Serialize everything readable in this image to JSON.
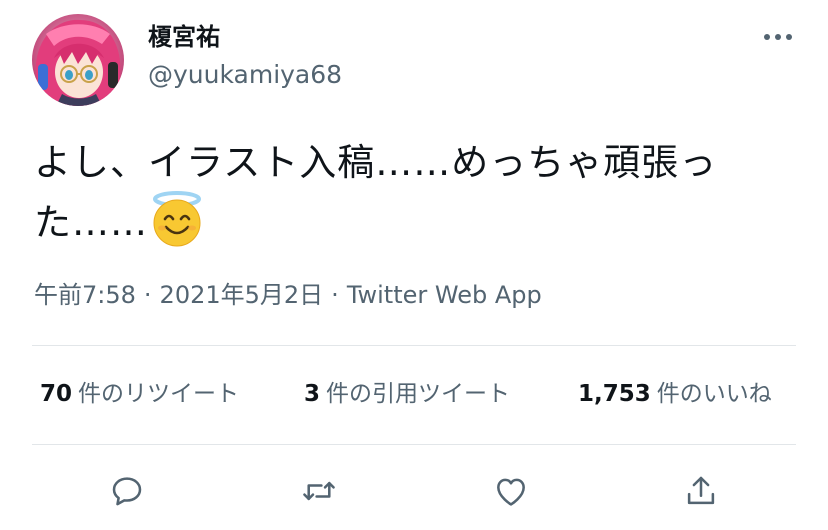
{
  "author": {
    "display_name": "榎宮祐",
    "handle": "@yuukamiya68",
    "avatar_icon": "user-avatar-image"
  },
  "tweet": {
    "text_lines": [
      "よし、イラスト入稿……めっちゃ頑張っ",
      "た……"
    ],
    "emoji": "smiling-face-with-halo"
  },
  "meta": {
    "time": "午前7:58",
    "separator": "·",
    "date": "2021年5月2日",
    "source": "Twitter Web App"
  },
  "stats": {
    "retweets": {
      "count": "70",
      "label": "件のリツイート"
    },
    "quotes": {
      "count": "3",
      "label": "件の引用ツイート"
    },
    "likes": {
      "count": "1,753",
      "label": "件のいいね"
    }
  },
  "actions": [
    "reply-icon",
    "retweet-icon",
    "like-icon",
    "share-icon"
  ],
  "colors": {
    "text": "#0f1419",
    "secondary": "#536471",
    "divider": "#e2e6e9",
    "emoji_face": "#f8c832",
    "halo": "#9fd4f3"
  }
}
